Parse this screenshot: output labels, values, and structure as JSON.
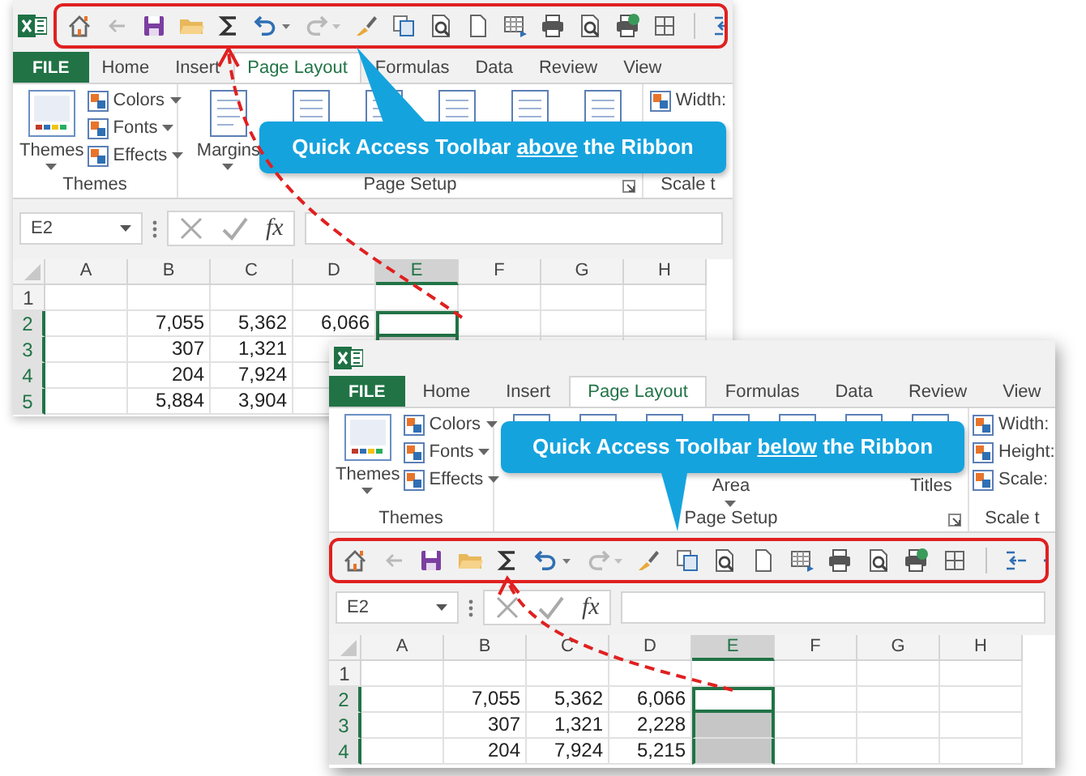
{
  "windows": [
    {
      "qat_above": [
        {
          "kind": "home",
          "disabled": false
        },
        {
          "kind": "back",
          "disabled": true
        },
        {
          "kind": "save",
          "disabled": false
        },
        {
          "kind": "open",
          "disabled": false
        },
        {
          "kind": "sum",
          "disabled": false
        },
        {
          "kind": "undo",
          "disabled": false
        },
        {
          "kind": "redo",
          "disabled": true
        },
        {
          "kind": "brush",
          "disabled": false
        },
        {
          "kind": "copy",
          "disabled": false
        },
        {
          "kind": "preview",
          "disabled": false
        },
        {
          "kind": "page",
          "disabled": false
        },
        {
          "kind": "table",
          "disabled": false
        },
        {
          "kind": "print",
          "disabled": false
        },
        {
          "kind": "preview",
          "disabled": false
        },
        {
          "kind": "printok",
          "disabled": false
        },
        {
          "kind": "grid",
          "disabled": false
        },
        {
          "kind": "separator"
        },
        {
          "kind": "indent",
          "disabled": false
        }
      ],
      "file_tab": "FILE",
      "tabs": [
        {
          "label": "Home",
          "selected": false
        },
        {
          "label": "Insert",
          "selected": false
        },
        {
          "label": "Page Layout",
          "selected": true
        },
        {
          "label": "Formulas",
          "selected": false
        },
        {
          "label": "Data",
          "selected": false
        },
        {
          "label": "Review",
          "selected": false
        },
        {
          "label": "View",
          "selected": false
        }
      ],
      "ribbon": [
        {
          "label": "Themes",
          "kind": "plain",
          "large": [
            {
              "label": "Themes",
              "dropdown": true
            }
          ],
          "small": [
            {
              "label": "Colors",
              "dropdown": true
            },
            {
              "label": "Fonts",
              "dropdown": true
            },
            {
              "label": "Effects",
              "dropdown": true
            }
          ]
        },
        {
          "label": "Page Setup",
          "kind": "launcher",
          "large": [
            {
              "label": "Margins",
              "dropdown": true
            },
            {
              "dropdown": false
            },
            {
              "dropdown": false
            },
            {
              "dropdown": false
            },
            {
              "dropdown": false
            },
            {
              "dropdown": false
            }
          ]
        },
        {
          "label": "Scale t",
          "kind": "plain",
          "small": [
            {
              "label": "Width:",
              "dropdown": false
            }
          ]
        }
      ],
      "name_box": "E2",
      "function_label": "fx",
      "columns": [
        {
          "label": "A",
          "selected": false
        },
        {
          "label": "B",
          "selected": false
        },
        {
          "label": "C",
          "selected": false
        },
        {
          "label": "D",
          "selected": false
        },
        {
          "label": "E",
          "selected": true
        },
        {
          "label": "F",
          "selected": false
        },
        {
          "label": "G",
          "selected": false
        },
        {
          "label": "H",
          "selected": false
        }
      ],
      "rows": [
        {
          "number": "1",
          "selected": false
        },
        {
          "number": "2",
          "selected": true,
          "cells": [
            null,
            "7,055",
            "5,362",
            "6,066",
            null,
            null,
            null,
            null
          ]
        },
        {
          "number": "3",
          "selected": true,
          "cells": [
            null,
            "307",
            "1,321"
          ]
        },
        {
          "number": "4",
          "selected": true,
          "cells": [
            null,
            "204",
            "7,924"
          ]
        },
        {
          "number": "5",
          "selected": true,
          "cells": [
            null,
            "5,884",
            "3,904"
          ]
        }
      ],
      "callout": {
        "before": "Quick Access Toolbar",
        "emphasis": "above",
        "after": "the Ribbon"
      }
    },
    {
      "file_tab": "FILE",
      "tabs": [
        {
          "label": "Home",
          "selected": false
        },
        {
          "label": "Insert",
          "selected": false
        },
        {
          "label": "Page Layout",
          "selected": true
        },
        {
          "label": "Formulas",
          "selected": false
        },
        {
          "label": "Data",
          "selected": false
        },
        {
          "label": "Review",
          "selected": false
        },
        {
          "label": "View",
          "selected": false
        }
      ],
      "ribbon": [
        {
          "label": "Themes",
          "kind": "plain",
          "large": [
            {
              "label": "Themes",
              "dropdown": true
            }
          ],
          "small": [
            {
              "label": "Colors",
              "dropdown": true
            },
            {
              "label": "Fonts",
              "dropdown": true
            },
            {
              "label": "Effects",
              "dropdown": true
            }
          ]
        },
        {
          "label": "Page Setup",
          "kind": "launcher",
          "large": [
            {
              "dropdown": true
            },
            {
              "dropdown": true
            },
            {
              "dropdown": true
            },
            {
              "label": "Area",
              "dropdown": true
            },
            {
              "dropdown": true
            },
            {
              "dropdown": false
            },
            {
              "label": "Titles",
              "dropdown": false
            }
          ]
        },
        {
          "label": "Scale t",
          "kind": "plain",
          "small": [
            {
              "label": "Width:",
              "dropdown": false
            },
            {
              "label": "Height:",
              "dropdown": false
            },
            {
              "label": "Scale:",
              "dropdown": false
            }
          ]
        }
      ],
      "qat_below": [
        {
          "kind": "home",
          "disabled": false
        },
        {
          "kind": "back",
          "disabled": true
        },
        {
          "kind": "save",
          "disabled": false
        },
        {
          "kind": "open",
          "disabled": false
        },
        {
          "kind": "sum",
          "disabled": false
        },
        {
          "kind": "undo",
          "disabled": false
        },
        {
          "kind": "redo",
          "disabled": true
        },
        {
          "kind": "brush",
          "disabled": false
        },
        {
          "kind": "copy",
          "disabled": false
        },
        {
          "kind": "preview",
          "disabled": false
        },
        {
          "kind": "page",
          "disabled": false
        },
        {
          "kind": "table",
          "disabled": false
        },
        {
          "kind": "print",
          "disabled": false
        },
        {
          "kind": "preview",
          "disabled": false
        },
        {
          "kind": "printok",
          "disabled": false
        },
        {
          "kind": "grid",
          "disabled": false
        },
        {
          "kind": "separator"
        },
        {
          "kind": "indent",
          "disabled": false
        },
        {
          "kind": "remove",
          "disabled": false
        }
      ],
      "name_box": "E2",
      "function_label": "fx",
      "columns": [
        {
          "label": "A",
          "selected": false
        },
        {
          "label": "B",
          "selected": false
        },
        {
          "label": "C",
          "selected": false
        },
        {
          "label": "D",
          "selected": false
        },
        {
          "label": "E",
          "selected": true
        },
        {
          "label": "F",
          "selected": false
        },
        {
          "label": "G",
          "selected": false
        },
        {
          "label": "H",
          "selected": false
        }
      ],
      "rows": [
        {
          "number": "1",
          "selected": false
        },
        {
          "number": "2",
          "selected": true,
          "cells": [
            null,
            "7,055",
            "5,362",
            "6,066",
            null,
            null,
            null,
            null
          ]
        },
        {
          "number": "3",
          "selected": true,
          "cells": [
            null,
            "307",
            "1,321",
            "2,228",
            null,
            null,
            null,
            null
          ]
        },
        {
          "number": "4",
          "selected": true,
          "cells": [
            null,
            "204",
            "7,924",
            "5,215",
            null,
            null,
            null,
            null
          ]
        }
      ],
      "callout": {
        "before": "Quick Access Toolbar",
        "emphasis": "below",
        "after": "the Ribbon"
      }
    }
  ]
}
